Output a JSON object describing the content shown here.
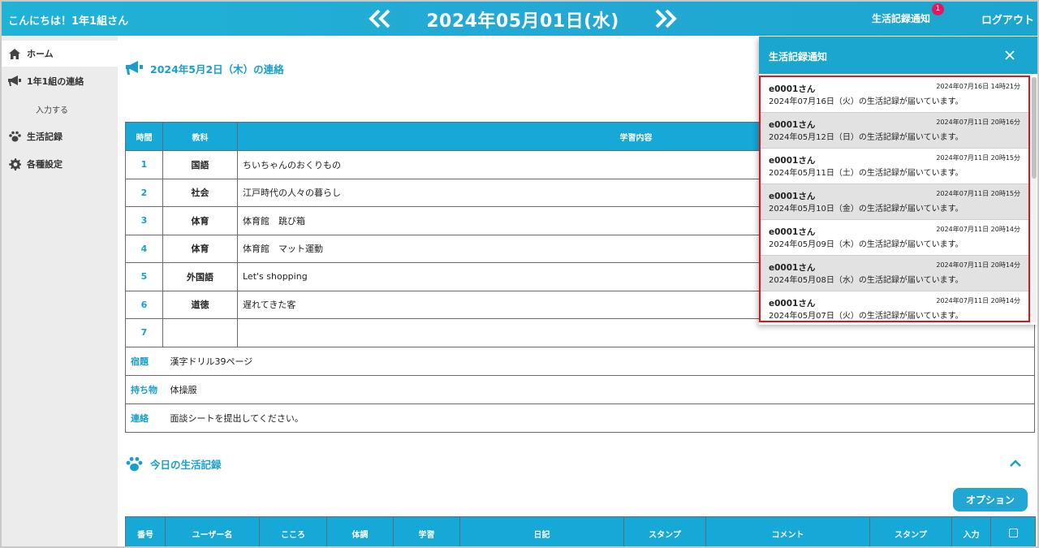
{
  "header": {
    "greeting": "こんにちは！1年1組さん",
    "date": "2024年05月01日(水)",
    "notify_label": "生活記録通知",
    "notify_count": "1",
    "logout_label": "ログアウト"
  },
  "sidebar": {
    "items": [
      {
        "label": "ホーム",
        "icon": "home-icon"
      },
      {
        "label": "1年1組の連絡",
        "icon": "megaphone-icon"
      },
      {
        "label": "入力する"
      },
      {
        "label": "生活記録",
        "icon": "paw-icon"
      },
      {
        "label": "各種設定",
        "icon": "gear-icon"
      }
    ]
  },
  "notice": {
    "title": "2024年5月2日（木）の連絡",
    "headers": [
      "時間",
      "教科",
      "学習内容"
    ],
    "rows": [
      {
        "num": "1",
        "subject": "国語",
        "content": "ちいちゃんのおくりもの"
      },
      {
        "num": "2",
        "subject": "社会",
        "content": "江戸時代の人々の暮らし"
      },
      {
        "num": "3",
        "subject": "体育",
        "content": "体育館　跳び箱"
      },
      {
        "num": "4",
        "subject": "体育",
        "content": "体育館　マット運動"
      },
      {
        "num": "5",
        "subject": "外国語",
        "content": "Let's shopping"
      },
      {
        "num": "6",
        "subject": "道徳",
        "content": "遅れてきた客"
      },
      {
        "num": "7",
        "subject": "",
        "content": ""
      }
    ],
    "homework_label": "宿題",
    "homework": "漢字ドリル39ページ",
    "belongings_label": "持ち物",
    "belongings": "体操服",
    "contact_label": "連絡",
    "contact": "面談シートを提出してください。"
  },
  "records": {
    "title": "今日の生活記録",
    "option_label": "オプション",
    "headers": [
      "番号",
      "ユーザー名",
      "こころ",
      "体調",
      "学習",
      "日記",
      "スタンプ",
      "コメント",
      "スタンプ",
      "入力"
    ]
  },
  "notifications": {
    "title": "生活記録通知",
    "items": [
      {
        "user": "e0001さん",
        "time": "2024年07月16日 14時21分",
        "message": "2024年07月16日（火）の生活記録が届いています。"
      },
      {
        "user": "e0001さん",
        "time": "2024年07月11日 20時16分",
        "message": "2024年05月12日（日）の生活記録が届いています。"
      },
      {
        "user": "e0001さん",
        "time": "2024年07月11日 20時15分",
        "message": "2024年05月11日（土）の生活記録が届いています。"
      },
      {
        "user": "e0001さん",
        "time": "2024年07月11日 20時15分",
        "message": "2024年05月10日（金）の生活記録が届いています。"
      },
      {
        "user": "e0001さん",
        "time": "2024年07月11日 20時14分",
        "message": "2024年05月09日（木）の生活記録が届いています。"
      },
      {
        "user": "e0001さん",
        "time": "2024年07月11日 20時14分",
        "message": "2024年05月08日（水）の生活記録が届いています。"
      },
      {
        "user": "e0001さん",
        "time": "2024年07月11日 20時14分",
        "message": "2024年05月07日（火）の生活記録が届いています。"
      }
    ]
  },
  "colors": {
    "accent": "#1ba6cf",
    "highlight": "#e0141b",
    "badge": "#e8175d"
  }
}
